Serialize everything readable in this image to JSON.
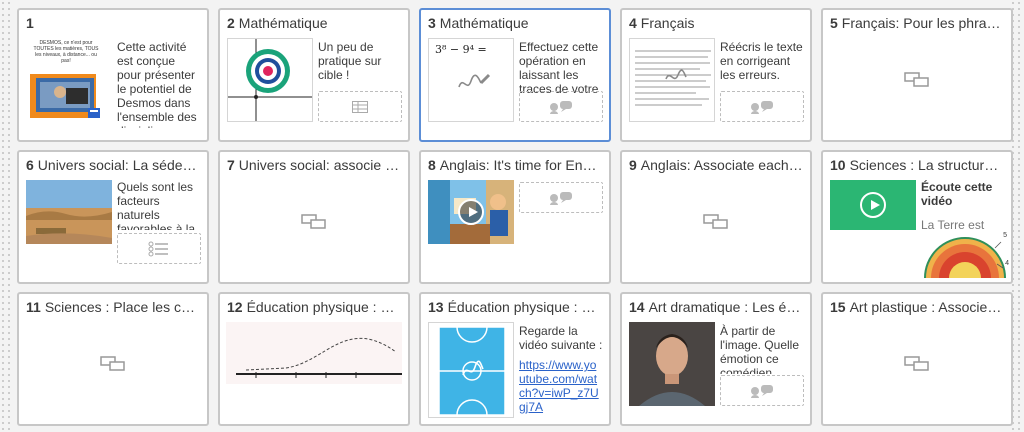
{
  "cards": [
    {
      "number": "1",
      "title": "",
      "desc": "Cette activité est conçue pour présenter le potentiel de Desmos dans l'ensemble des disciplines.",
      "thumb_text": "DESMOS, ce n'est pour TOUTES les matières, TOUS les niveaux, à distance... ou pas!",
      "response": "none"
    },
    {
      "number": "2",
      "title": "Mathématique",
      "desc": "Un peu de pratique sur cible !",
      "response": "table-icon"
    },
    {
      "number": "3",
      "title": "Mathématique",
      "desc": "Effectuez cette opération en laissant les traces de votre",
      "thumb_text": "3⁸ − 9⁴ =",
      "response": "comment-icon"
    },
    {
      "number": "4",
      "title": "Français",
      "desc": "Réécris le texte en corrigeant les erreurs.",
      "response": "comment-icon"
    },
    {
      "number": "5",
      "title": "Français: Pour les phrases",
      "response": "slides-icon"
    },
    {
      "number": "6",
      "title": "Univers social: La sédentarisation",
      "desc": "Quels sont les facteurs naturels favorables à la",
      "response": "list-icon"
    },
    {
      "number": "7",
      "title": "Univers social: associe chaque",
      "response": "slides-icon"
    },
    {
      "number": "8",
      "title": "Anglais: It's time for English",
      "response": "comment-icon"
    },
    {
      "number": "9",
      "title": "Anglais: Associate each image",
      "response": "slides-icon"
    },
    {
      "number": "10",
      "title": "Sciences : La structure interne",
      "desc_bold": "Écoute cette vidéo",
      "desc_extra": "La Terre est",
      "labels": [
        "5",
        "4"
      ],
      "response": "none"
    },
    {
      "number": "11",
      "title": "Sciences : Place les couches",
      "response": "slides-icon"
    },
    {
      "number": "12",
      "title": "Éducation physique : Quel",
      "response": "none"
    },
    {
      "number": "13",
      "title": "Éducation physique : Pour",
      "desc": "Regarde la vidéo suivante :",
      "link": "https://www.youtube.com/watch?v=iwP_z7Ugj7A",
      "response": "none"
    },
    {
      "number": "14",
      "title": "Art dramatique : Les émotions",
      "desc": "À partir de l'image. Quelle émotion ce comédien",
      "response": "comment-icon"
    },
    {
      "number": "15",
      "title": "Art plastique : Associez chaque",
      "response": "slides-icon"
    }
  ],
  "active_card": "3",
  "colors": {
    "active_border": "#5c8ed6",
    "card_border": "#c7c7c7",
    "link": "#2a62c9",
    "video_green": "#2bb673"
  }
}
